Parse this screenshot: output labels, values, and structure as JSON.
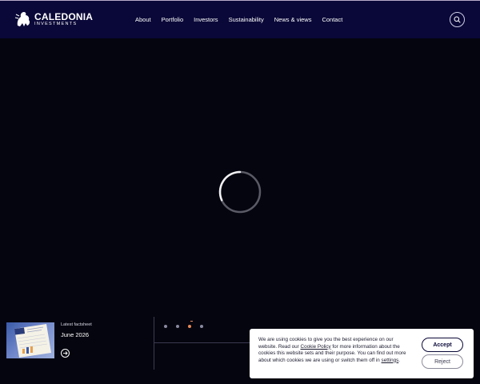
{
  "brand": {
    "title": "CALEDONIA",
    "subtitle": "INVESTMENTS",
    "logo_icon": "lion-crest-icon"
  },
  "nav": {
    "items": [
      {
        "label": "About"
      },
      {
        "label": "Portfolio"
      },
      {
        "label": "Investors"
      },
      {
        "label": "Sustainability"
      },
      {
        "label": "News & views"
      },
      {
        "label": "Contact"
      }
    ],
    "search_icon": "search-icon"
  },
  "hero": {
    "state": "loading"
  },
  "factsheet": {
    "label": "Latest factsheet",
    "date": "June 2026",
    "arrow_icon": "arrow-right-icon"
  },
  "carousel": {
    "slide_count": 4,
    "active_index": 2
  },
  "cookie_banner": {
    "text_1": "We are using cookies to give you the best experience on our website. Read our ",
    "policy_link": "Cookie Policy",
    "text_2": " for more information about the cookies this website sets and their purpose. You can find out more about which cookies we are using or switch them off in ",
    "settings_link": "settings",
    "text_3": ".",
    "accept_label": "Accept",
    "reject_label": "Reject"
  },
  "colors": {
    "header_bg": "#0a0838",
    "page_bg": "#05050f",
    "accent": "#e88a5a"
  }
}
